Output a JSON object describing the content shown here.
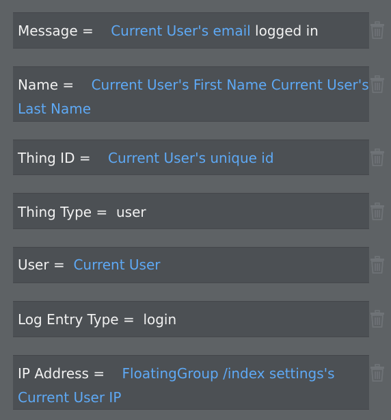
{
  "fields": [
    {
      "key": "Message",
      "eq": " =    ",
      "parts": [
        {
          "type": "dynamic",
          "text": "Current User's email"
        },
        {
          "type": "static",
          "text": " logged in"
        }
      ]
    },
    {
      "key": "Name",
      "eq": " =    ",
      "parts": [
        {
          "type": "dynamic",
          "text": "Current User's First Name Current User's"
        },
        {
          "type": "dynamic",
          "text": "Last Name"
        }
      ]
    },
    {
      "key": "Thing ID",
      "eq": " =    ",
      "parts": [
        {
          "type": "dynamic",
          "text": "Current User's unique id"
        }
      ]
    },
    {
      "key": "Thing Type",
      "eq": " =  ",
      "parts": [
        {
          "type": "static",
          "text": "user"
        }
      ]
    },
    {
      "key": "User",
      "eq": " =  ",
      "parts": [
        {
          "type": "dynamic",
          "text": "Current User"
        }
      ]
    },
    {
      "key": "Log Entry Type",
      "eq": " =  ",
      "parts": [
        {
          "type": "static",
          "text": "login"
        }
      ]
    },
    {
      "key": "IP Address",
      "eq": " =    ",
      "parts": [
        {
          "type": "dynamic",
          "text": "FloatingGroup /index settings's"
        },
        {
          "type": "dynamic",
          "text": "Current User IP"
        }
      ]
    }
  ],
  "icons": {
    "delete": "trash-icon"
  },
  "colors": {
    "background": "#5e6265",
    "field_background": "#4c5054",
    "text": "#f1f1f1",
    "dynamic_expression": "#5ea9f5",
    "trash_icon": "#6f7377"
  }
}
